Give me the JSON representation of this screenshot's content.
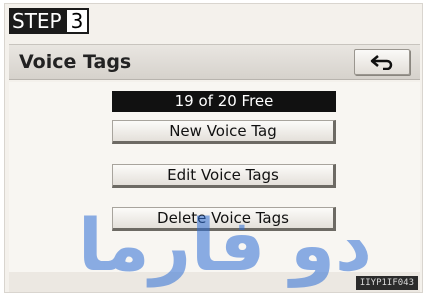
{
  "step": {
    "word": "STEP",
    "number": "3"
  },
  "screen": {
    "title": "Voice Tags",
    "back_icon": "return-arrow-icon"
  },
  "status": {
    "free_text": "19 of 20 Free"
  },
  "buttons": {
    "new_voice_tag": "New Voice Tag",
    "edit_voice_tags": "Edit Voice Tags",
    "delete_voice_tags": "Delete Voice Tags"
  },
  "footer": {
    "image_code": "IIYP1IF043"
  },
  "watermark": {
    "text": "دو فارما"
  },
  "colors": {
    "background": "#f4f1ec",
    "title_bar": "#ddd9d3",
    "status_bar": "#111111",
    "watermark": "#2f6fd6"
  }
}
